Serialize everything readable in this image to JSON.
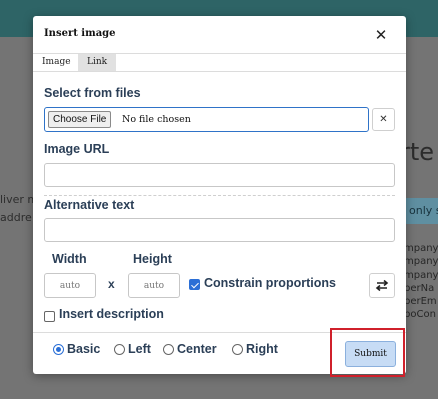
{
  "background": {
    "heading_fragment": "rte",
    "left_line_1": "liver m",
    "left_line_2": "addre",
    "chip_text": "only s",
    "list_lines": [
      "mpany",
      "mpany",
      "mpany",
      "perNa",
      "perEm",
      "boCon"
    ]
  },
  "dialog": {
    "title": "Insert image",
    "close_glyph": "✕",
    "tabs": [
      {
        "label": "Image",
        "active": true
      },
      {
        "label": "Link",
        "active": false
      }
    ],
    "select_files": {
      "label": "Select from files",
      "button_label": "Choose File",
      "status": "No file chosen",
      "clear_glyph": "✕"
    },
    "image_url": {
      "label": "Image URL",
      "value": "",
      "placeholder": ""
    },
    "alt_text": {
      "label": "Alternative text",
      "value": "",
      "placeholder": ""
    },
    "dimensions": {
      "width_label": "Width",
      "height_label": "Height",
      "width_placeholder": "auto",
      "height_placeholder": "auto",
      "separator": "x",
      "constrain_label": "Constrain proportions",
      "constrain_checked": true,
      "swap_icon": "swap-arrows-icon"
    },
    "insert_description": {
      "label": "Insert description",
      "checked": false
    },
    "layout_options": [
      {
        "label": "Basic",
        "selected": true
      },
      {
        "label": "Left",
        "selected": false
      },
      {
        "label": "Center",
        "selected": false
      },
      {
        "label": "Right",
        "selected": false
      }
    ],
    "submit_label": "Submit"
  },
  "colors": {
    "accent": "#2b6fd6",
    "label_text": "#2b3f57",
    "submit_bg": "#c7dcf5",
    "highlight": "#d0202b",
    "topbar": "#2e6466"
  }
}
